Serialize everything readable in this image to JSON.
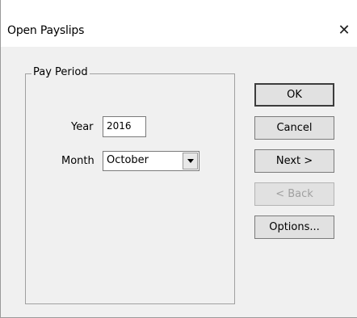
{
  "window": {
    "title": "Open Payslips",
    "close_glyph": "✕"
  },
  "pay_period": {
    "group_label": "Pay Period",
    "year_label": "Year",
    "year_value": "2016",
    "month_label": "Month",
    "month_value": "October"
  },
  "buttons": {
    "ok": "OK",
    "cancel": "Cancel",
    "next": "Next >",
    "back": "< Back",
    "options": "Options..."
  },
  "icons": {
    "close": "close-icon",
    "dropdown": "chevron-down-icon"
  }
}
